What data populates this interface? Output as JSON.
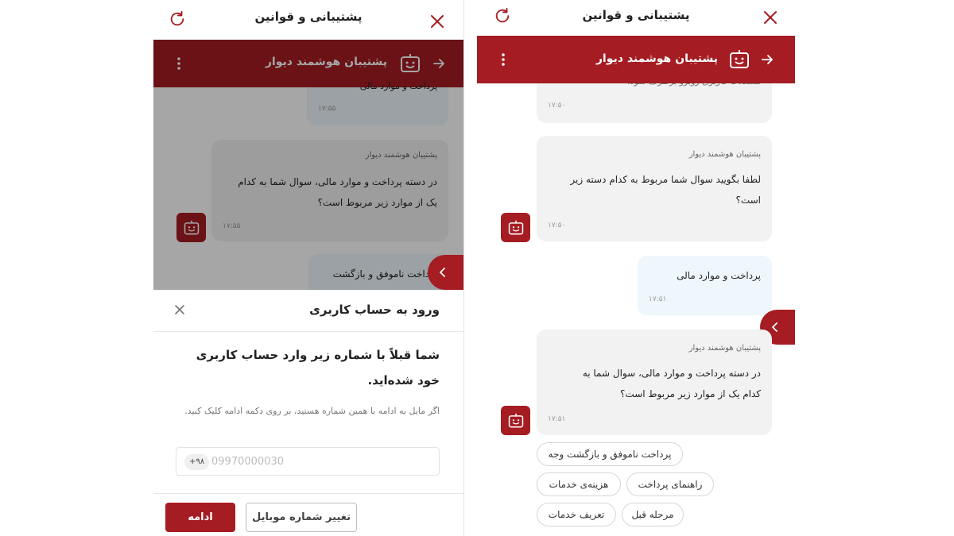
{
  "left_screen": {
    "top_title": "پشتیبانی و قوانین",
    "bot_name": "پشتیبان هوشمند دیوار",
    "chat": {
      "partial_top_text": "پرداخت و موارد مالی",
      "partial_top_time": "۱۷:۵۵",
      "bot_message": {
        "sender": "پشتیبان هوشمند دیوار",
        "text": "در دسته پرداخت و موارد مالی، سوال شما به کدام یک از موارد زیر مربوط است؟",
        "time": "۱۷:۵۵"
      },
      "partial_user_text": "پرداخت ناموفق و بازگشت"
    },
    "login_sheet": {
      "title": "ورود به حساب کاربری",
      "headline": "شما قبلاً با شماره زیر وارد حساب کاربری خود شده‌اید.",
      "hint": "اگر مایل به ادامه با همین شماره هستید، بر روی دکمه ادامه کلیک کنید.",
      "phone_prefix": "+۹۸",
      "phone_value": "09970000030",
      "continue_label": "ادامه",
      "change_number_label": "تغییر شماره موبایل"
    }
  },
  "right_screen": {
    "top_title": "پشتیبانی و قوانین",
    "bot_name": "پشتیبان هوشمند دیوار",
    "messages": [
      {
        "type": "bot",
        "sender": "",
        "text": "مشکلات کاربری روبرو برطرف شود.",
        "time": "۱۷:۵۰"
      },
      {
        "type": "bot",
        "sender": "پشتیبان هوشمند دیوار",
        "text": "لطفا بگویید سوال شما مربوط به کدام دسته زیر است؟",
        "time": "۱۷:۵۰"
      },
      {
        "type": "user",
        "sender": "",
        "text": "پرداخت و موارد مالی",
        "time": "۱۷:۵۱"
      },
      {
        "type": "bot",
        "sender": "پشتیبان هوشمند دیوار",
        "text": "در دسته پرداخت و موارد مالی، سوال شما به کدام یک از موارد زیر مربوط است؟",
        "time": "۱۷:۵۱"
      }
    ],
    "quick_replies": [
      "پرداخت ناموفق و بازگشت وجه",
      "راهنمای پرداخت",
      "هزینه‌ی خدمات",
      "مرحله قبل",
      "تعریف خدمات"
    ]
  },
  "colors": {
    "brand": "#a51c22",
    "user_bubble": "#eef7fc",
    "bot_bubble": "#f2f2f2"
  },
  "icons": [
    "refresh-icon",
    "close-icon",
    "back-arrow-icon",
    "robot-icon",
    "more-vertical-icon",
    "chevron-left-icon"
  ]
}
